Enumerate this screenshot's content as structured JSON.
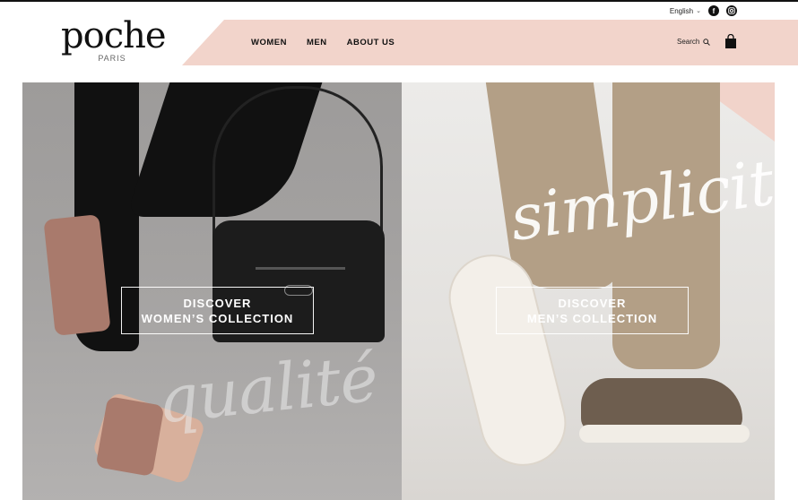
{
  "header": {
    "language": "English",
    "social": [
      {
        "name": "facebook-icon",
        "glyph": "f"
      },
      {
        "name": "instagram-icon"
      }
    ],
    "logo": {
      "word": "poche",
      "sub": "PARIS"
    },
    "nav": [
      {
        "label": "WOMEN"
      },
      {
        "label": "MEN"
      },
      {
        "label": "ABOUT US"
      }
    ],
    "search_label": "Search"
  },
  "hero": {
    "left": {
      "script": "qualité",
      "cta_line1": "DISCOVER",
      "cta_line2": "WOMEN’S COLLECTION"
    },
    "right": {
      "script": "simplicité",
      "cta_line1": "DISCOVER",
      "cta_line2": "MEN’S COLLECTION"
    }
  },
  "colors": {
    "accent_pink": "#f2d4cb",
    "text_dark": "#111111"
  }
}
